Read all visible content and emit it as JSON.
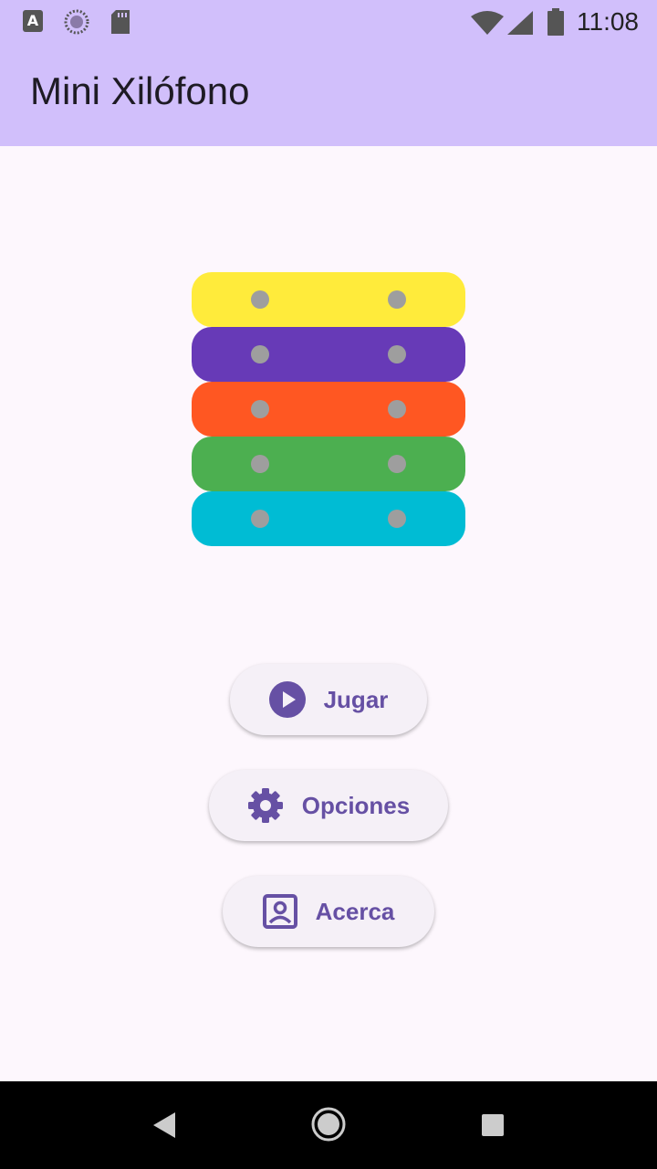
{
  "status_bar": {
    "time": "11:08",
    "icons": [
      "keyboard-a-icon",
      "loading-circle-icon",
      "sd-card-icon",
      "wifi-icon",
      "cell-signal-icon",
      "battery-icon"
    ]
  },
  "app_bar": {
    "title": "Mini Xilófono"
  },
  "xylophone": {
    "bars": [
      {
        "color": "#ffeb3b"
      },
      {
        "color": "#673ab7"
      },
      {
        "color": "#ff5722"
      },
      {
        "color": "#4caf50"
      },
      {
        "color": "#00bcd4"
      }
    ],
    "pin_color": "#9e9e9e"
  },
  "menu": {
    "play_label": "Jugar",
    "play_icon": "play-circle-icon",
    "options_label": "Opciones",
    "options_icon": "gear-icon",
    "about_label": "Acerca",
    "about_icon": "contact-portrait-icon",
    "accent_color": "#6650a4"
  },
  "nav_bar": {
    "icons": [
      "back-icon",
      "home-icon",
      "recents-icon"
    ]
  }
}
